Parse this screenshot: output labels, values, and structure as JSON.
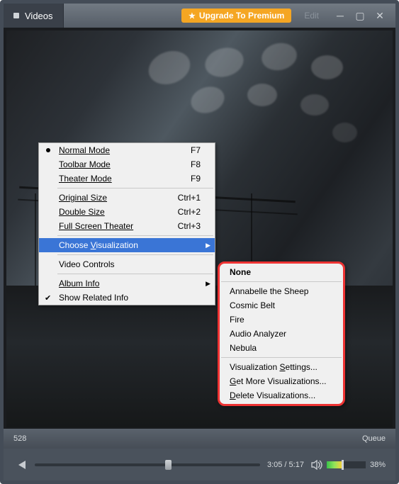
{
  "titlebar": {
    "tab_label": "Videos",
    "premium_label": "Upgrade To Premium",
    "edit_label": "Edit"
  },
  "menu": {
    "normal_mode": "Normal Mode",
    "normal_mode_key": "F7",
    "toolbar_mode": "Toolbar Mode",
    "toolbar_mode_key": "F8",
    "theater_mode": "Theater Mode",
    "theater_mode_key": "F9",
    "original_size": "Original Size",
    "original_size_key": "Ctrl+1",
    "double_size": "Double Size",
    "double_size_key": "Ctrl+2",
    "full_screen_theater": "Full Screen Theater",
    "full_screen_theater_key": "Ctrl+3",
    "choose_visualization": "Choose Visualization",
    "video_controls": "Video Controls",
    "album_info": "Album Info",
    "show_related_info": "Show Related Info"
  },
  "submenu": {
    "none": "None",
    "annabelle": "Annabelle the Sheep",
    "cosmic_belt": "Cosmic Belt",
    "fire": "Fire",
    "audio_analyzer": "Audio Analyzer",
    "nebula": "Nebula",
    "viz_settings": "Visualization Settings...",
    "get_more": "Get More Visualizations...",
    "delete_viz": "Delete Visualizations..."
  },
  "status": {
    "left_value": "528",
    "queue": "Queue"
  },
  "controls": {
    "time": "3:05 / 5:17",
    "volume_pct": "38%"
  }
}
